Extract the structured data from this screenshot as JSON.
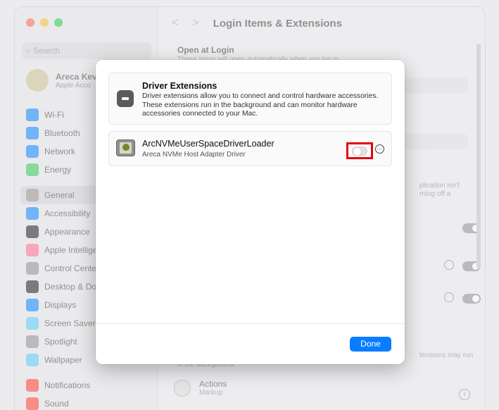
{
  "window": {
    "traffic_colors": [
      "#ff5f57",
      "#febc2e",
      "#28c840"
    ]
  },
  "sidebar": {
    "search_placeholder": "Search",
    "account": {
      "name": "Areca Kev",
      "sub": "Apple Acco"
    },
    "items": [
      {
        "label": "Wi-Fi",
        "color": "#0a84ff"
      },
      {
        "label": "Bluetooth",
        "color": "#0a84ff"
      },
      {
        "label": "Network",
        "color": "#0a84ff"
      },
      {
        "label": "Energy",
        "color": "#34c759"
      },
      {
        "label": "General",
        "color": "#8e8e93",
        "selected": true
      },
      {
        "label": "Accessibility",
        "color": "#0a84ff"
      },
      {
        "label": "Appearance",
        "color": "#1c1c1e"
      },
      {
        "label": "Apple Intellige",
        "color": "#ff6b8b"
      },
      {
        "label": "Control Cente",
        "color": "#8e8e93"
      },
      {
        "label": "Desktop & Do",
        "color": "#1c1c1e"
      },
      {
        "label": "Displays",
        "color": "#0a84ff"
      },
      {
        "label": "Screen Saver",
        "color": "#5ac8fa"
      },
      {
        "label": "Spotlight",
        "color": "#8e8e93"
      },
      {
        "label": "Wallpaper",
        "color": "#5ac8fa"
      },
      {
        "label": "Notifications",
        "color": "#ff3b30"
      },
      {
        "label": "Sound",
        "color": "#ff3b30"
      }
    ]
  },
  "main": {
    "title": "Login Items & Extensions",
    "open_at_login": "Open at Login",
    "open_at_login_sub": "These items will open automatically when you log in.",
    "bg_text_1": "plication isn't",
    "bg_text_2": "rning off a",
    "bg_text_3": "tensions may run",
    "bg_text_4": "in the background.",
    "actions_label": "Actions",
    "actions_sub": "Markup"
  },
  "sheet": {
    "header_title": "Driver Extensions",
    "header_desc": "Driver extensions allow you to connect and control hardware accessories. These extensions run in the background and can monitor hardware accessories connected to your Mac.",
    "driver_name": "ArcNVMeUserSpaceDriverLoader",
    "driver_sub": "Areca NVMe Host Adapter Driver",
    "toggle_on": false,
    "more_glyph": "…",
    "done_label": "Done"
  }
}
